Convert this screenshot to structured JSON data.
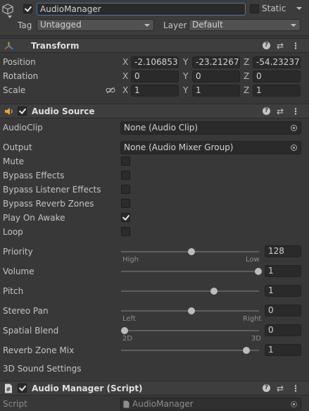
{
  "header": {
    "name": "AudioManager",
    "static_label": "Static",
    "tag_label": "Tag",
    "tag_value": "Untagged",
    "layer_label": "Layer",
    "layer_value": "Default",
    "active": true,
    "is_static": false
  },
  "transform": {
    "title": "Transform",
    "rows": [
      {
        "label": "Position",
        "x": "-2.106853",
        "y": "-23.21267",
        "z": "-54.23237"
      },
      {
        "label": "Rotation",
        "x": "0",
        "y": "0",
        "z": "0"
      },
      {
        "label": "Scale",
        "x": "1",
        "y": "1",
        "z": "1"
      }
    ],
    "axes": [
      "X",
      "Y",
      "Z"
    ]
  },
  "audio_source": {
    "title": "Audio Source",
    "enabled": true,
    "clip_label": "AudioClip",
    "clip_value": "None (Audio Clip)",
    "output_label": "Output",
    "output_value": "None (Audio Mixer Group)",
    "toggles": [
      {
        "label": "Mute",
        "checked": false
      },
      {
        "label": "Bypass Effects",
        "checked": false
      },
      {
        "label": "Bypass Listener Effects",
        "checked": false
      },
      {
        "label": "Bypass Reverb Zones",
        "checked": false
      },
      {
        "label": "Play On Awake",
        "checked": true
      },
      {
        "label": "Loop",
        "checked": false
      }
    ],
    "sliders": [
      {
        "label": "Priority",
        "value": "128",
        "fraction": 0.5,
        "left_sub": "High",
        "right_sub": "Low"
      },
      {
        "label": "Volume",
        "value": "1",
        "fraction": 1.0
      },
      {
        "label": "Pitch",
        "value": "1",
        "fraction": 0.667
      },
      {
        "label": "Stereo Pan",
        "value": "0",
        "fraction": 0.5,
        "left_sub": "Left",
        "right_sub": "Right"
      },
      {
        "label": "Spatial Blend",
        "value": "0",
        "fraction": 0.0,
        "left_sub": "2D",
        "right_sub": "3D"
      },
      {
        "label": "Reverb Zone Mix",
        "value": "1",
        "fraction": 0.909
      }
    ],
    "sound_settings_label": "3D Sound Settings"
  },
  "script_component": {
    "title": "Audio Manager (Script)",
    "script_label": "Script",
    "script_value": "AudioManager"
  },
  "colors": {
    "panel": "#383838",
    "header": "#3e3e3e",
    "field": "#2a2a2a",
    "transform_icon_red": "#e0483d",
    "transform_icon_green": "#6bc13b",
    "transform_icon_blue": "#3c8ee6",
    "audio_icon": "#f0a424"
  }
}
